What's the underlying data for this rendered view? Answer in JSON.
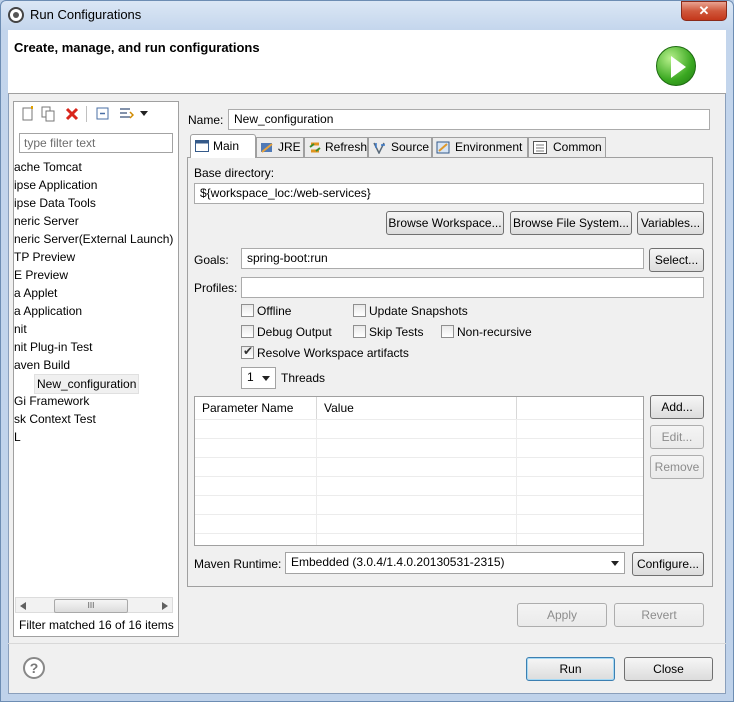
{
  "window": {
    "title": "Run Configurations",
    "close_glyph": "✕"
  },
  "header": {
    "title": "Create, manage, and run configurations",
    "icon": "run-icon"
  },
  "left": {
    "filter_placeholder": "type filter text",
    "tree": [
      "ache Tomcat",
      "ipse Application",
      "ipse Data Tools",
      "neric Server",
      "neric Server(External Launch)",
      "TP Preview",
      "E Preview",
      "a Applet",
      "a Application",
      "nit",
      "nit Plug-in Test",
      "aven Build",
      "New_configuration",
      "Gi Framework",
      "sk Context Test",
      "L"
    ],
    "scroll_glyph": "III",
    "status": "Filter matched 16 of 16 items"
  },
  "form": {
    "name_label": "Name:",
    "name_value": "New_configuration",
    "tabs": [
      "Main",
      "JRE",
      "Refresh",
      "Source",
      "Environment",
      "Common"
    ],
    "base_dir_label": "Base directory:",
    "base_dir_value": "${workspace_loc:/web-services}",
    "browse_workspace": "Browse Workspace...",
    "browse_fs": "Browse File System...",
    "variables": "Variables...",
    "goals_label": "Goals:",
    "goals_value": "spring-boot:run",
    "select": "Select...",
    "profiles_label": "Profiles:",
    "profiles_value": "",
    "offline": "Offline",
    "update_snapshots": "Update Snapshots",
    "debug_output": "Debug Output",
    "skip_tests": "Skip Tests",
    "non_recursive": "Non-recursive",
    "resolve_workspace": "Resolve Workspace artifacts",
    "threads_value": "1",
    "threads_label": "Threads",
    "table_headers": [
      "Parameter Name",
      "Value"
    ],
    "add": "Add...",
    "edit": "Edit...",
    "remove": "Remove",
    "maven_runtime_label": "Maven Runtime:",
    "maven_runtime_value": "Embedded (3.0.4/1.4.0.20130531-2315)",
    "configure": "Configure...",
    "apply": "Apply",
    "revert": "Revert"
  },
  "footer": {
    "help": "?",
    "run": "Run",
    "close": "Close"
  }
}
